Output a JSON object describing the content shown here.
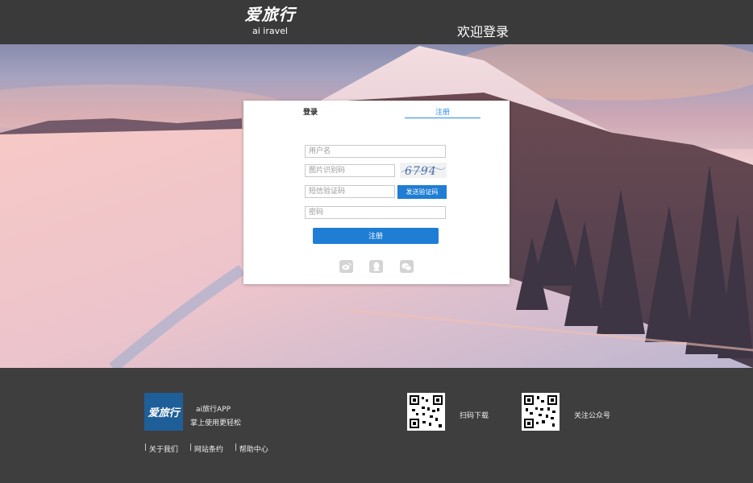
{
  "header": {
    "logo_text": "爱旅行",
    "logo_sub": "ai iravel",
    "welcome": "欢迎登录"
  },
  "login": {
    "tabs": [
      {
        "label": "登录",
        "active": false
      },
      {
        "label": "注册",
        "active": true
      }
    ],
    "fields": {
      "username_placeholder": "用户名",
      "captcha_placeholder": "图片识别码",
      "sms_placeholder": "短信验证码",
      "password_placeholder": "密码"
    },
    "captcha_text": "6794",
    "sms_button": "发送验证码",
    "submit_button": "注册",
    "social": [
      "weibo-icon",
      "qq-icon",
      "wechat-icon"
    ]
  },
  "footer": {
    "logo_text": "爱旅行",
    "app_name": "ai旅行APP",
    "app_slogan": "掌上使用更轻松",
    "links": [
      "关于我们",
      "网站条约",
      "帮助中心"
    ],
    "qr": [
      {
        "label": "扫码下载"
      },
      {
        "label": "关注公众号"
      }
    ]
  },
  "colors": {
    "accent": "#1f7dd4",
    "header_bg": "#3a3a3a",
    "footer_bg": "#3e3e3e"
  }
}
